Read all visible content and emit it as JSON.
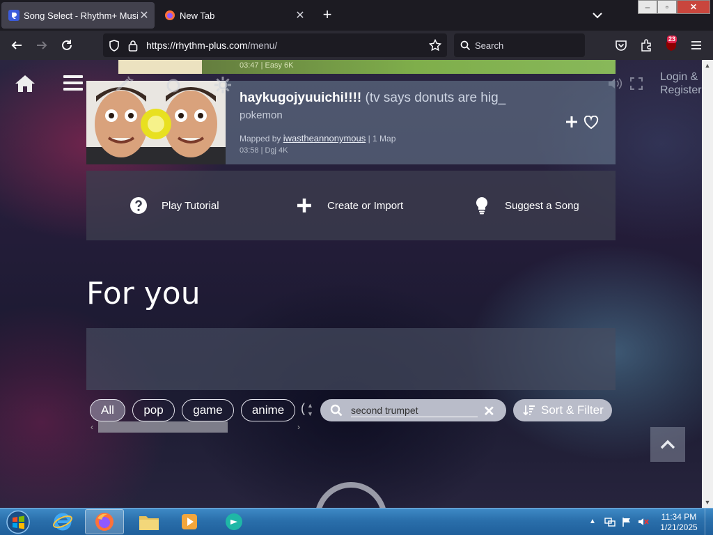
{
  "browser": {
    "tabs": [
      {
        "title": "Song Select - Rhythm+ Music Game",
        "active": true
      },
      {
        "title": "New Tab",
        "active": false
      }
    ],
    "url_host": "https://rhythm-plus.com",
    "url_path": "/menu/",
    "search_placeholder": "Search",
    "extension_badge": "23",
    "window_controls": {
      "minimize": "–",
      "maximize": "▫",
      "close": "✕"
    }
  },
  "page": {
    "top_strip_meta": "03:47 | Easy 6K",
    "login_label": "Login &",
    "register_label": "Register",
    "song_card": {
      "title_bold": "haykugojyuuichi!!!!",
      "title_rest": " (tv says donuts are hig_",
      "subtitle": "pokemon",
      "mapped_prefix": "Mapped by ",
      "mapper": "iwastheannonymous",
      "map_count": " | 1 Map",
      "stats": "03:58 | Dgj 4K"
    },
    "actions": [
      {
        "label": "Play Tutorial",
        "icon": "question-circle-icon"
      },
      {
        "label": "Create or Import",
        "icon": "plus-icon"
      },
      {
        "label": "Suggest a Song",
        "icon": "lightbulb-icon"
      }
    ],
    "section_title": "For you",
    "chips": [
      "All",
      "pop",
      "game",
      "anime"
    ],
    "chip_partial": "(",
    "search_value": "second trumpet",
    "sort_filter_label": "Sort & Filter"
  },
  "taskbar": {
    "apps": [
      "internet-explorer",
      "firefox",
      "file-explorer",
      "media-player",
      "app"
    ],
    "time": "11:34 PM",
    "date": "1/21/2025"
  },
  "colors": {
    "tab_active": "#42414d",
    "chrome_dark": "#1c1b22",
    "card": "#6e8296",
    "taskbar": "#2a6fab",
    "close_red": "#c9463d"
  }
}
